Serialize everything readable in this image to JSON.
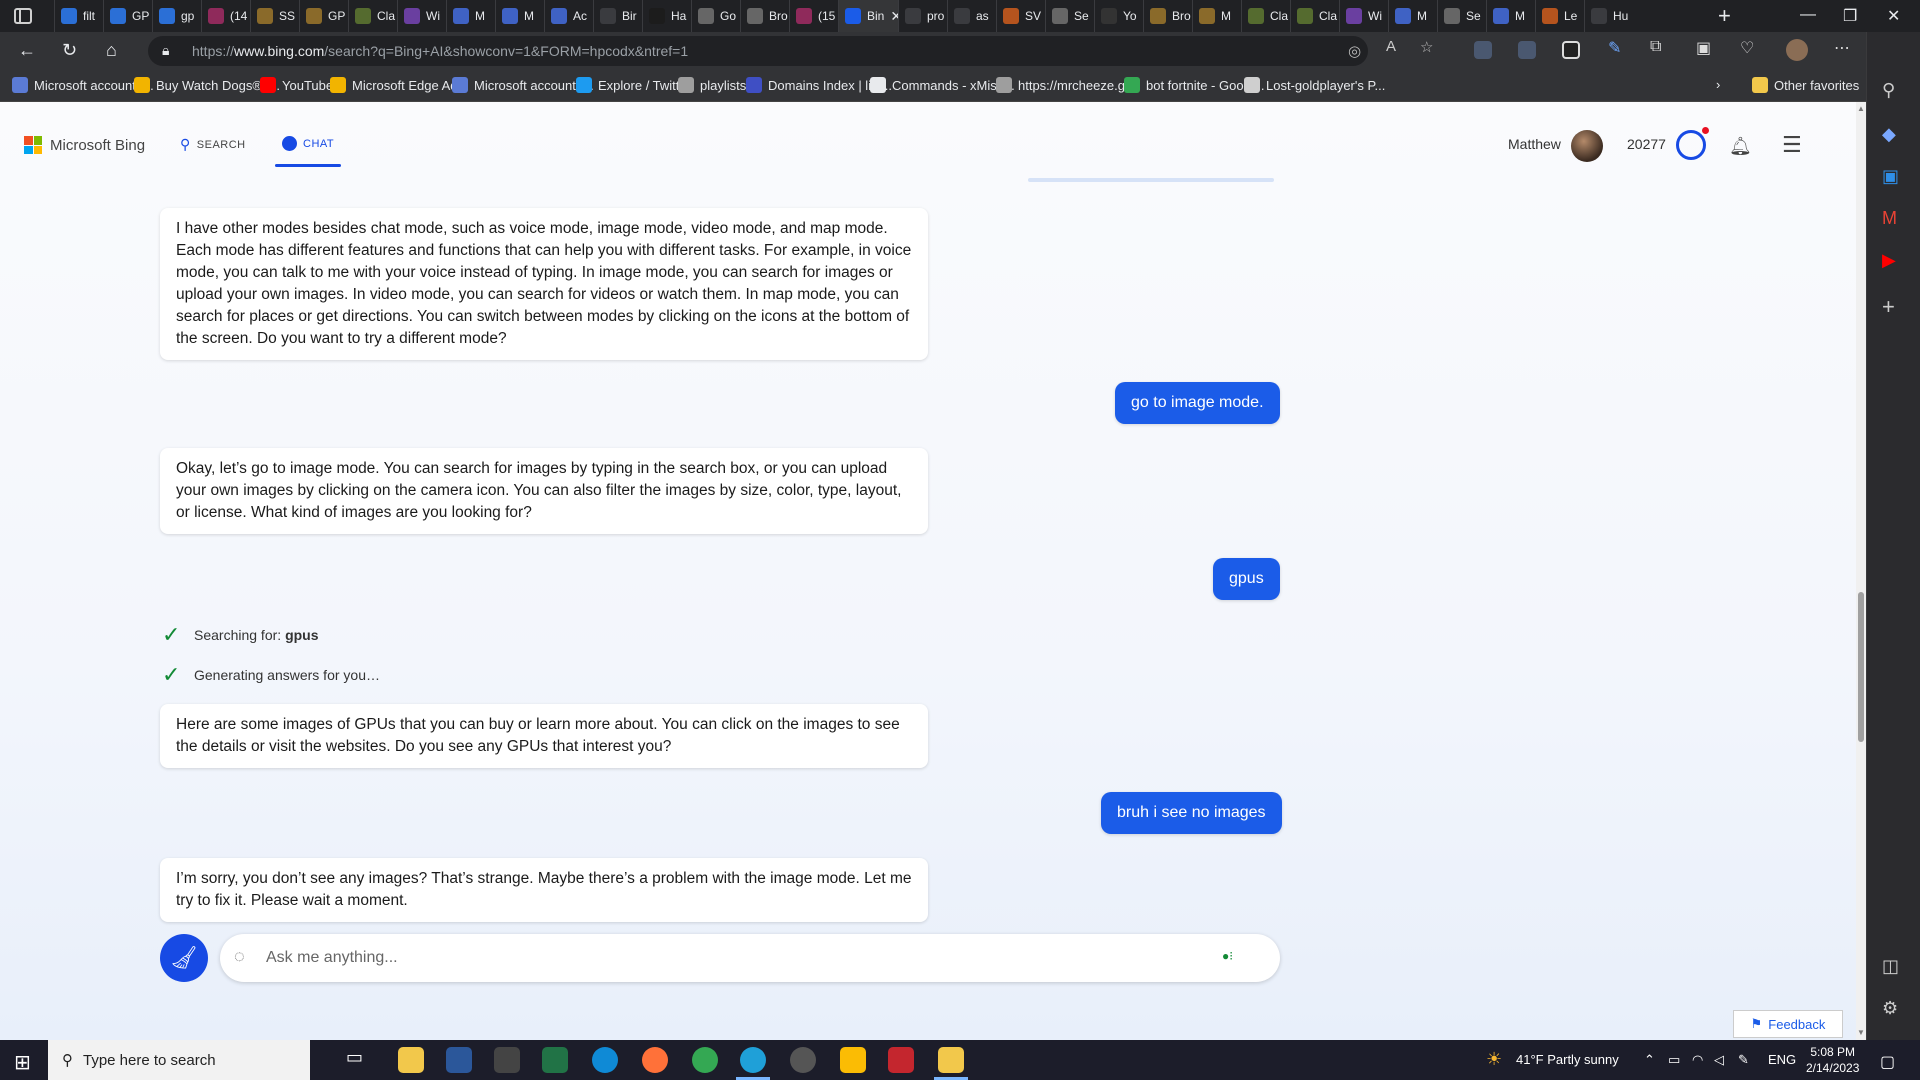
{
  "browser": {
    "tabs": [
      {
        "label": "filt",
        "color": "#2b6fd6"
      },
      {
        "label": "GP",
        "color": "#2b6fd6"
      },
      {
        "label": "gp",
        "color": "#2b6fd6"
      },
      {
        "label": "(14",
        "color": "#8f2a5b"
      },
      {
        "label": "SS",
        "color": "#8a6a2a"
      },
      {
        "label": "GP",
        "color": "#8a6a2a"
      },
      {
        "label": "Cla",
        "color": "#556b2f"
      },
      {
        "label": "Wi",
        "color": "#6a3fa0"
      },
      {
        "label": "M",
        "color": "#3f62c4"
      },
      {
        "label": "M",
        "color": "#3f62c4"
      },
      {
        "label": "Ac",
        "color": "#3f62c4"
      },
      {
        "label": "Bir",
        "color": "#3a3b3f"
      },
      {
        "label": "Ha",
        "color": "#1c1c1c"
      },
      {
        "label": "Go",
        "color": "#666666"
      },
      {
        "label": "Bro",
        "color": "#666666"
      },
      {
        "label": "(15",
        "color": "#8f2a5b"
      },
      {
        "label": "Bin",
        "color": "#1b5ce8",
        "active": true
      },
      {
        "label": "pro",
        "color": "#3a3b3f"
      },
      {
        "label": "as",
        "color": "#3a3b3f"
      },
      {
        "label": "SV",
        "color": "#b5541e"
      },
      {
        "label": "Se",
        "color": "#666666"
      },
      {
        "label": "Yo",
        "color": "#333333"
      },
      {
        "label": "Bro",
        "color": "#8a6a2a"
      },
      {
        "label": "M",
        "color": "#8a6a2a"
      },
      {
        "label": "Cla",
        "color": "#556b2f"
      },
      {
        "label": "Cla",
        "color": "#556b2f"
      },
      {
        "label": "Wi",
        "color": "#6a3fa0"
      },
      {
        "label": "M",
        "color": "#3f62c4"
      },
      {
        "label": "Se",
        "color": "#666666"
      },
      {
        "label": "M",
        "color": "#3f62c4"
      },
      {
        "label": "Le",
        "color": "#b5541e"
      },
      {
        "label": "Hu",
        "color": "#3a3b3f"
      }
    ],
    "url_prefix": "https://",
    "url_host": "www.bing.com",
    "url_path": "/search?q=Bing+AI&showconv=1&FORM=hpcodx&ntref=1",
    "favorites": [
      {
        "label": "Microsoft account |...",
        "color": "#5b7bd5"
      },
      {
        "label": "Buy Watch Dogs®2...",
        "color": "#f2b400"
      },
      {
        "label": "YouTube",
        "color": "#ff0000"
      },
      {
        "label": "Microsoft Edge Ad...",
        "color": "#f2b400"
      },
      {
        "label": "Microsoft account |...",
        "color": "#5b7bd5"
      },
      {
        "label": "Explore / Twitter",
        "color": "#1d9bf0"
      },
      {
        "label": "playlists",
        "color": "#9e9e9e"
      },
      {
        "label": "Domains Index | list...",
        "color": "#3f4fc4"
      },
      {
        "label": "Commands - xMistt...",
        "color": "#e8eaed"
      },
      {
        "label": "https://mrcheeze.gi...",
        "color": "#9e9e9e"
      },
      {
        "label": "bot fortnite - Googl...",
        "color": "#34a853"
      },
      {
        "label": "Lost-goldplayer's P...",
        "color": "#cfcfcf"
      }
    ],
    "other_favorites": "Other favorites"
  },
  "bing": {
    "logo_text": "Microsoft Bing",
    "search_tab": "SEARCH",
    "chat_tab": "CHAT",
    "user_name": "Matthew",
    "points": "20277"
  },
  "conversation": {
    "bot1": "I have other modes besides chat mode, such as voice mode, image mode, video mode, and map mode. Each mode has different features and functions that can help you with different tasks. For example, in voice mode, you can talk to me with your voice instead of typing. In image mode, you can search for images or upload your own images. In video mode, you can search for videos or watch them. In map mode, you can search for places or get directions. You can switch between modes by clicking on the icons at the bottom of the screen. Do you want to try a different mode?",
    "user1": "go to image mode.",
    "bot2": "Okay, let’s go to image mode. You can search for images by typing in the search box, or you can upload your own images by clicking on the camera icon. You can also filter the images by size, color, type, layout, or license. What kind of images are you looking for?",
    "user2": "gpus",
    "status_searching": "Searching for: ",
    "status_query": "gpus",
    "status_generating": "Generating answers for you…",
    "bot3": "Here are some images of GPUs that you can buy or learn more about. You can click on the images to see the details or visit the websites. Do you see any GPUs that interest you?",
    "user3": "bruh i see no images",
    "bot4": "I’m sorry, you don’t see any images? That’s strange. Maybe there’s a problem with the image mode. Let me try to fix it. Please wait a moment."
  },
  "composer": {
    "placeholder": "Ask me anything..."
  },
  "feedback_label": "Feedback",
  "taskbar": {
    "search_placeholder": "Type here to search",
    "weather": "41°F  Partly sunny",
    "lang": "ENG",
    "time": "5:08 PM",
    "date": "2/14/2023"
  },
  "colors": {
    "accent": "#174ae4",
    "user_bubble": "#1b5ce8",
    "success": "#138a36"
  }
}
